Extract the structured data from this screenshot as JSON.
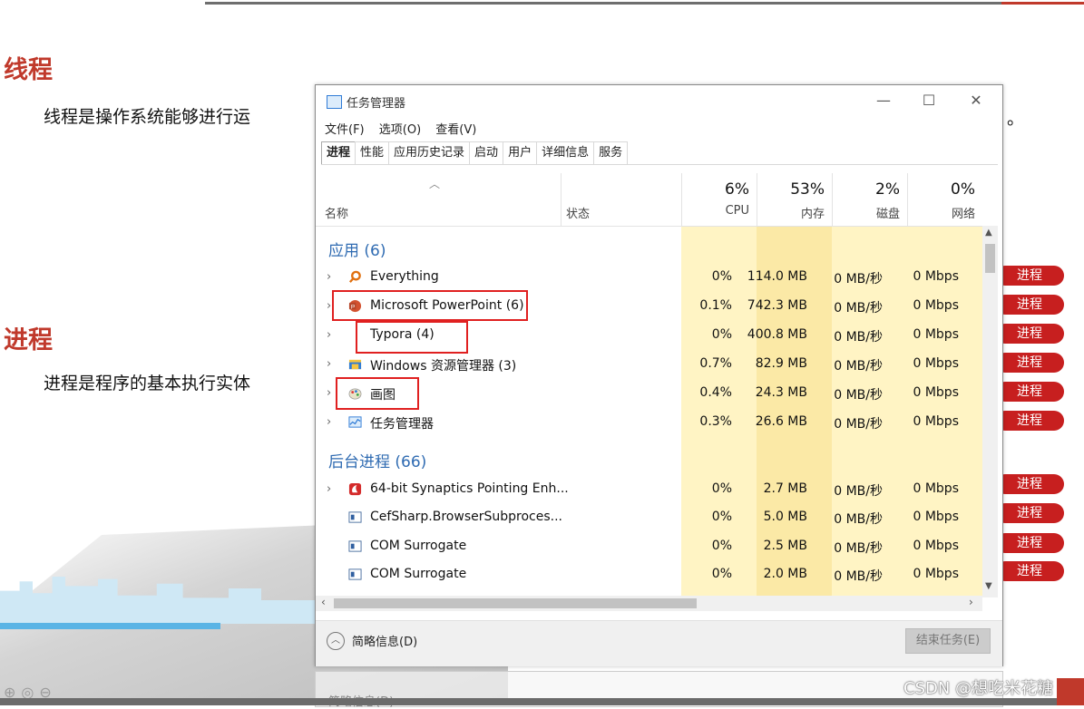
{
  "slide": {
    "heading_thread": "线程",
    "para_thread_left": "线程是操作系统能够进行运",
    "para_thread_right": "。",
    "heading_process": "进程",
    "para_process_left": "进程是程序的基本执行实体"
  },
  "badge_label": "进程",
  "watermark": "CSDN @想吃米花糖",
  "window": {
    "title": "任务管理器",
    "minimize": "—",
    "maximize": "☐",
    "close": "✕",
    "menu": [
      "文件(F)",
      "选项(O)",
      "查看(V)"
    ],
    "tabs": [
      "进程",
      "性能",
      "应用历史记录",
      "启动",
      "用户",
      "详细信息",
      "服务"
    ],
    "active_tab": "进程",
    "columns": {
      "name": "名称",
      "status": "状态",
      "cpu_pct": "6%",
      "cpu": "CPU",
      "mem_pct": "53%",
      "mem": "内存",
      "disk_pct": "2%",
      "disk": "磁盘",
      "net_pct": "0%",
      "net": "网络"
    },
    "group_apps": "应用 (6)",
    "group_bg": "后台进程 (66)",
    "apps": [
      {
        "name": "Everything",
        "cpu": "0%",
        "mem": "114.0 MB",
        "disk": "0 MB/秒",
        "net": "0 Mbps"
      },
      {
        "name": "Microsoft PowerPoint (6)",
        "cpu": "0.1%",
        "mem": "742.3 MB",
        "disk": "0 MB/秒",
        "net": "0 Mbps"
      },
      {
        "name": "Typora (4)",
        "cpu": "0%",
        "mem": "400.8 MB",
        "disk": "0 MB/秒",
        "net": "0 Mbps"
      },
      {
        "name": "Windows 资源管理器 (3)",
        "cpu": "0.7%",
        "mem": "82.9 MB",
        "disk": "0 MB/秒",
        "net": "0 Mbps"
      },
      {
        "name": "画图",
        "cpu": "0.4%",
        "mem": "24.3 MB",
        "disk": "0 MB/秒",
        "net": "0 Mbps"
      },
      {
        "name": "任务管理器",
        "cpu": "0.3%",
        "mem": "26.6 MB",
        "disk": "0 MB/秒",
        "net": "0 Mbps"
      }
    ],
    "bg": [
      {
        "name": "64-bit Synaptics Pointing Enh...",
        "cpu": "0%",
        "mem": "2.7 MB",
        "disk": "0 MB/秒",
        "net": "0 Mbps"
      },
      {
        "name": "CefSharp.BrowserSubproces...",
        "cpu": "0%",
        "mem": "5.0 MB",
        "disk": "0 MB/秒",
        "net": "0 Mbps"
      },
      {
        "name": "COM Surrogate",
        "cpu": "0%",
        "mem": "2.5 MB",
        "disk": "0 MB/秒",
        "net": "0 Mbps"
      },
      {
        "name": "COM Surrogate",
        "cpu": "0%",
        "mem": "2.0 MB",
        "disk": "0 MB/秒",
        "net": "0 Mbps"
      }
    ],
    "footer_less": "简略信息(D)",
    "footer_end": "结束任务(E)"
  },
  "ghost_footer": "简略信息(D)",
  "colors": {
    "accent_red": "#c0392b",
    "badge_red": "#c71f1f",
    "group_blue": "#2f6bb2",
    "heat": "#fff4c4"
  },
  "icons": [
    "search-icon",
    "powerpoint-icon",
    "typora-icon",
    "folder-icon",
    "paint-icon",
    "taskmgr-icon",
    "synaptics-icon",
    "window-icon"
  ]
}
